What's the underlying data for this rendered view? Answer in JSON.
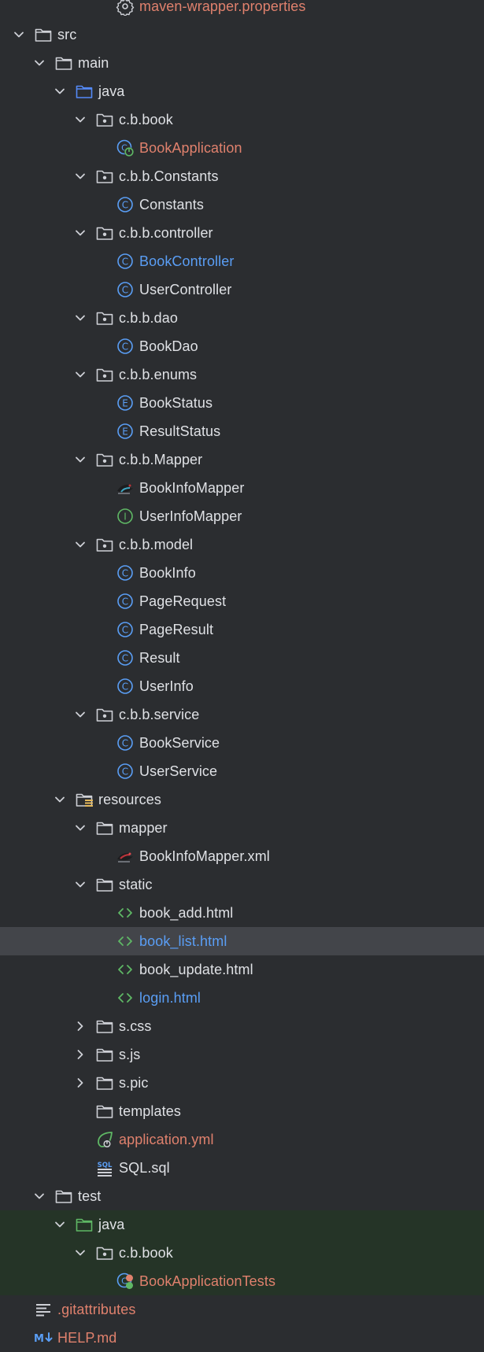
{
  "colors": {
    "background": "#2b2d30",
    "text": "#dfe1e5",
    "modified_text": "#e0816d",
    "changed_text": "#5a9ef5",
    "selection": "#43454a",
    "test_background": "#253427",
    "class_icon": "#5a9ef5",
    "interface_icon": "#5fb865",
    "html_icon": "#5fb865"
  },
  "tree": [
    {
      "depth": 4,
      "icon": "gear-icon",
      "label": "maven-wrapper.properties",
      "color": "red"
    },
    {
      "depth": 0,
      "chevron": "down",
      "icon": "folder-icon",
      "label": "src"
    },
    {
      "depth": 1,
      "chevron": "down",
      "icon": "folder-icon",
      "label": "main"
    },
    {
      "depth": 2,
      "chevron": "down",
      "icon": "source-folder-icon",
      "label": "java"
    },
    {
      "depth": 3,
      "chevron": "down",
      "icon": "package-icon",
      "label": "c.b.book"
    },
    {
      "depth": 4,
      "icon": "spring-boot-class-icon",
      "label": "BookApplication",
      "color": "red"
    },
    {
      "depth": 3,
      "chevron": "down",
      "icon": "package-icon",
      "label": "c.b.b.Constants"
    },
    {
      "depth": 4,
      "icon": "class-icon",
      "label": "Constants"
    },
    {
      "depth": 3,
      "chevron": "down",
      "icon": "package-icon",
      "label": "c.b.b.controller"
    },
    {
      "depth": 4,
      "icon": "class-icon",
      "label": "BookController",
      "color": "blue"
    },
    {
      "depth": 4,
      "icon": "class-icon",
      "label": "UserController"
    },
    {
      "depth": 3,
      "chevron": "down",
      "icon": "package-icon",
      "label": "c.b.b.dao"
    },
    {
      "depth": 4,
      "icon": "class-icon",
      "label": "BookDao"
    },
    {
      "depth": 3,
      "chevron": "down",
      "icon": "package-icon",
      "label": "c.b.b.enums"
    },
    {
      "depth": 4,
      "icon": "enum-icon",
      "label": "BookStatus"
    },
    {
      "depth": 4,
      "icon": "enum-icon",
      "label": "ResultStatus"
    },
    {
      "depth": 3,
      "chevron": "down",
      "icon": "package-icon",
      "label": "c.b.b.Mapper"
    },
    {
      "depth": 4,
      "icon": "mybatis-icon",
      "label": "BookInfoMapper"
    },
    {
      "depth": 4,
      "icon": "interface-icon",
      "label": "UserInfoMapper"
    },
    {
      "depth": 3,
      "chevron": "down",
      "icon": "package-icon",
      "label": "c.b.b.model"
    },
    {
      "depth": 4,
      "icon": "class-icon",
      "label": "BookInfo"
    },
    {
      "depth": 4,
      "icon": "class-icon",
      "label": "PageRequest"
    },
    {
      "depth": 4,
      "icon": "class-icon",
      "label": "PageResult"
    },
    {
      "depth": 4,
      "icon": "class-icon",
      "label": "Result"
    },
    {
      "depth": 4,
      "icon": "class-icon",
      "label": "UserInfo"
    },
    {
      "depth": 3,
      "chevron": "down",
      "icon": "package-icon",
      "label": "c.b.b.service"
    },
    {
      "depth": 4,
      "icon": "class-icon",
      "label": "BookService"
    },
    {
      "depth": 4,
      "icon": "class-icon",
      "label": "UserService"
    },
    {
      "depth": 2,
      "chevron": "down",
      "icon": "resources-folder-icon",
      "label": "resources"
    },
    {
      "depth": 3,
      "chevron": "down",
      "icon": "folder-icon",
      "label": "mapper"
    },
    {
      "depth": 4,
      "icon": "mybatis-xml-icon",
      "label": "BookInfoMapper.xml"
    },
    {
      "depth": 3,
      "chevron": "down",
      "icon": "folder-icon",
      "label": "static"
    },
    {
      "depth": 4,
      "icon": "html-icon",
      "label": "book_add.html"
    },
    {
      "depth": 4,
      "icon": "html-icon",
      "label": "book_list.html",
      "color": "blue",
      "selected": true
    },
    {
      "depth": 4,
      "icon": "html-icon",
      "label": "book_update.html"
    },
    {
      "depth": 4,
      "icon": "html-icon",
      "label": "login.html",
      "color": "blue"
    },
    {
      "depth": 3,
      "chevron": "right",
      "icon": "folder-icon",
      "label": "s.css"
    },
    {
      "depth": 3,
      "chevron": "right",
      "icon": "folder-icon",
      "label": "s.js"
    },
    {
      "depth": 3,
      "chevron": "right",
      "icon": "folder-icon",
      "label": "s.pic"
    },
    {
      "depth": 3,
      "icon": "folder-icon",
      "label": "templates"
    },
    {
      "depth": 3,
      "icon": "spring-yml-icon",
      "label": "application.yml",
      "color": "red"
    },
    {
      "depth": 3,
      "icon": "sql-icon",
      "label": "SQL.sql"
    },
    {
      "depth": 1,
      "chevron": "down",
      "icon": "folder-icon",
      "label": "test"
    },
    {
      "depth": 2,
      "chevron": "down",
      "icon": "test-source-folder-icon",
      "label": "java",
      "test": true
    },
    {
      "depth": 3,
      "chevron": "down",
      "icon": "package-icon",
      "label": "c.b.book",
      "test": true
    },
    {
      "depth": 4,
      "icon": "test-class-icon",
      "label": "BookApplicationTests",
      "color": "red",
      "test": true
    },
    {
      "depth": 0,
      "icon": "text-file-icon",
      "label": ".gitattributes",
      "color": "red"
    },
    {
      "depth": 0,
      "icon": "markdown-icon",
      "label": "HELP.md",
      "color": "red"
    }
  ]
}
